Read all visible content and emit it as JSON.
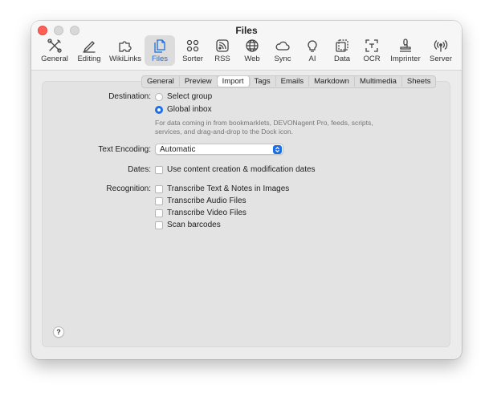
{
  "window": {
    "title": "Files"
  },
  "toolbar": {
    "items": [
      {
        "label": "General",
        "icon": "tools-icon"
      },
      {
        "label": "Editing",
        "icon": "pencil-icon"
      },
      {
        "label": "WikiLinks",
        "icon": "puzzle-icon"
      },
      {
        "label": "Files",
        "icon": "files-icon",
        "selected": true
      },
      {
        "label": "Sorter",
        "icon": "sorter-icon"
      },
      {
        "label": "RSS",
        "icon": "rss-icon"
      },
      {
        "label": "Web",
        "icon": "globe-icon"
      },
      {
        "label": "Sync",
        "icon": "cloud-icon"
      },
      {
        "label": "AI",
        "icon": "lightbulb-icon"
      },
      {
        "label": "Data",
        "icon": "data-icon"
      },
      {
        "label": "OCR",
        "icon": "ocr-icon"
      },
      {
        "label": "Imprinter",
        "icon": "stamp-icon"
      },
      {
        "label": "Server",
        "icon": "antenna-icon"
      }
    ]
  },
  "tabs": [
    {
      "label": "General"
    },
    {
      "label": "Preview"
    },
    {
      "label": "Import",
      "active": true
    },
    {
      "label": "Tags"
    },
    {
      "label": "Emails"
    },
    {
      "label": "Markdown"
    },
    {
      "label": "Multimedia"
    },
    {
      "label": "Sheets"
    }
  ],
  "import": {
    "destination_label": "Destination:",
    "destination_options": [
      {
        "label": "Select group",
        "selected": false
      },
      {
        "label": "Global inbox",
        "selected": true
      }
    ],
    "destination_note": "For data coming in from bookmarklets, DEVONagent Pro, feeds, scripts, services, and drag-and-drop to the Dock icon.",
    "encoding_label": "Text Encoding:",
    "encoding_value": "Automatic",
    "dates_label": "Dates:",
    "dates_option": {
      "label": "Use content creation & modification dates",
      "checked": false
    },
    "recognition_label": "Recognition:",
    "recognition_options": [
      {
        "label": "Transcribe Text & Notes in Images",
        "checked": false
      },
      {
        "label": "Transcribe Audio Files",
        "checked": false
      },
      {
        "label": "Transcribe Video Files",
        "checked": false
      },
      {
        "label": "Scan barcodes",
        "checked": false
      }
    ]
  },
  "help": {
    "label": "?"
  },
  "colors": {
    "accent": "#1b6fe6",
    "close": "#ff5f57"
  }
}
